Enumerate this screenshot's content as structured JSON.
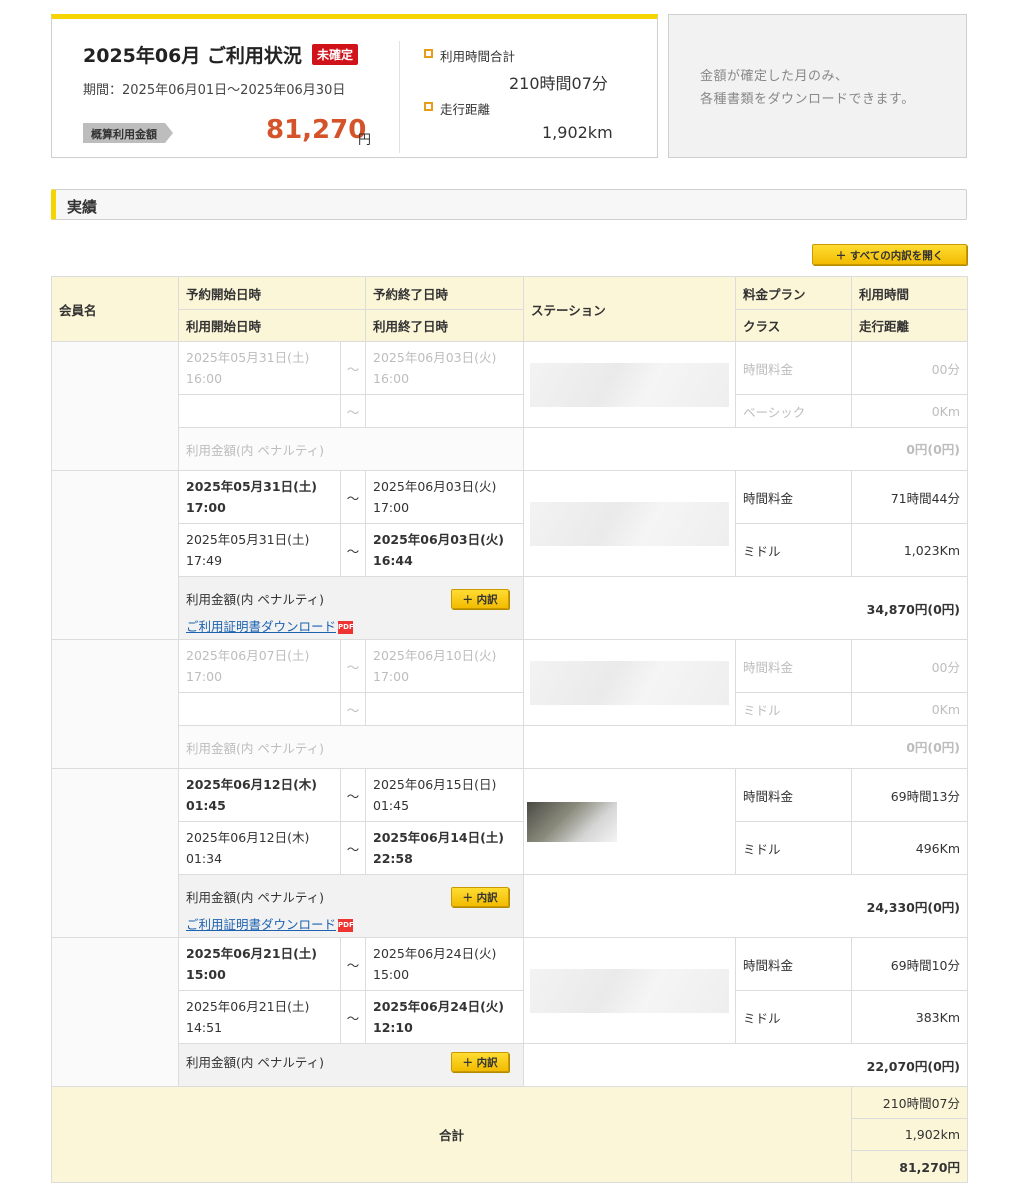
{
  "summary": {
    "title": "2025年06月 ご利用状況",
    "badge": "未確定",
    "period": "期間：2025年06月01日～2025年06月30日",
    "amount_label": "概算利用金額",
    "amount_value": "81,270",
    "amount_unit": "円",
    "usage_time_label": "利用時間合計",
    "usage_time_value": "210時間07分",
    "distance_label": "走行距離",
    "distance_value": "1,902km"
  },
  "notice": {
    "line1": "金額が確定した月のみ、",
    "line2": "各種書類をダウンロードできます。"
  },
  "section_title": "実績",
  "expand_all_label": "すべての内訳を開く",
  "table": {
    "headers": {
      "member": "会員名",
      "reserve_start": "予約開始日時",
      "reserve_end": "予約終了日時",
      "use_start": "利用開始日時",
      "use_end": "利用終了日時",
      "station": "ステーション",
      "plan": "料金プラン",
      "class": "クラス",
      "time": "利用時間",
      "distance": "走行距離"
    },
    "tilde": "～",
    "penalty_label": "利用金額(内 ペナルティ)",
    "detail_button": "内訳",
    "download_label": "ご利用証明書ダウンロード",
    "rows": [
      {
        "res_start_date": "2025年05月31日(土)",
        "res_start_time": "16:00",
        "res_end_date": "2025年06月03日(火)",
        "res_end_time": "16:00",
        "use_start_date": "",
        "use_start_time": "",
        "use_end_date": "",
        "use_end_time": "",
        "plan": "時間料金",
        "class": "ベーシック",
        "time": "00分",
        "distance": "0Km",
        "amount": "0円(0円)"
      },
      {
        "res_start_date": "2025年05月31日(土)",
        "res_start_time": "17:00",
        "res_end_date": "2025年06月03日(火)",
        "res_end_time": "17:00",
        "use_start_date": "2025年05月31日(土)",
        "use_start_time": "17:49",
        "use_end_date": "2025年06月03日(火)",
        "use_end_time": "16:44",
        "plan": "時間料金",
        "class": "ミドル",
        "time": "71時間44分",
        "distance": "1,023Km",
        "amount": "34,870円(0円)"
      },
      {
        "res_start_date": "2025年06月07日(土)",
        "res_start_time": "17:00",
        "res_end_date": "2025年06月10日(火)",
        "res_end_time": "17:00",
        "use_start_date": "",
        "use_start_time": "",
        "use_end_date": "",
        "use_end_time": "",
        "plan": "時間料金",
        "class": "ミドル",
        "time": "00分",
        "distance": "0Km",
        "amount": "0円(0円)"
      },
      {
        "res_start_date": "2025年06月12日(木)",
        "res_start_time": "01:45",
        "res_end_date": "2025年06月15日(日)",
        "res_end_time": "01:45",
        "use_start_date": "2025年06月12日(木)",
        "use_start_time": "01:34",
        "use_end_date": "2025年06月14日(土)",
        "use_end_time": "22:58",
        "plan": "時間料金",
        "class": "ミドル",
        "time": "69時間13分",
        "distance": "496Km",
        "amount": "24,330円(0円)"
      },
      {
        "res_start_date": "2025年06月21日(土)",
        "res_start_time": "15:00",
        "res_end_date": "2025年06月24日(火)",
        "res_end_time": "15:00",
        "use_start_date": "2025年06月21日(土)",
        "use_start_time": "14:51",
        "use_end_date": "2025年06月24日(火)",
        "use_end_time": "12:10",
        "plan": "時間料金",
        "class": "ミドル",
        "time": "69時間10分",
        "distance": "383Km",
        "amount": "22,070円(0円)"
      }
    ],
    "total": {
      "label": "合計",
      "time": "210時間07分",
      "distance": "1,902km",
      "amount": "81,270円"
    }
  }
}
